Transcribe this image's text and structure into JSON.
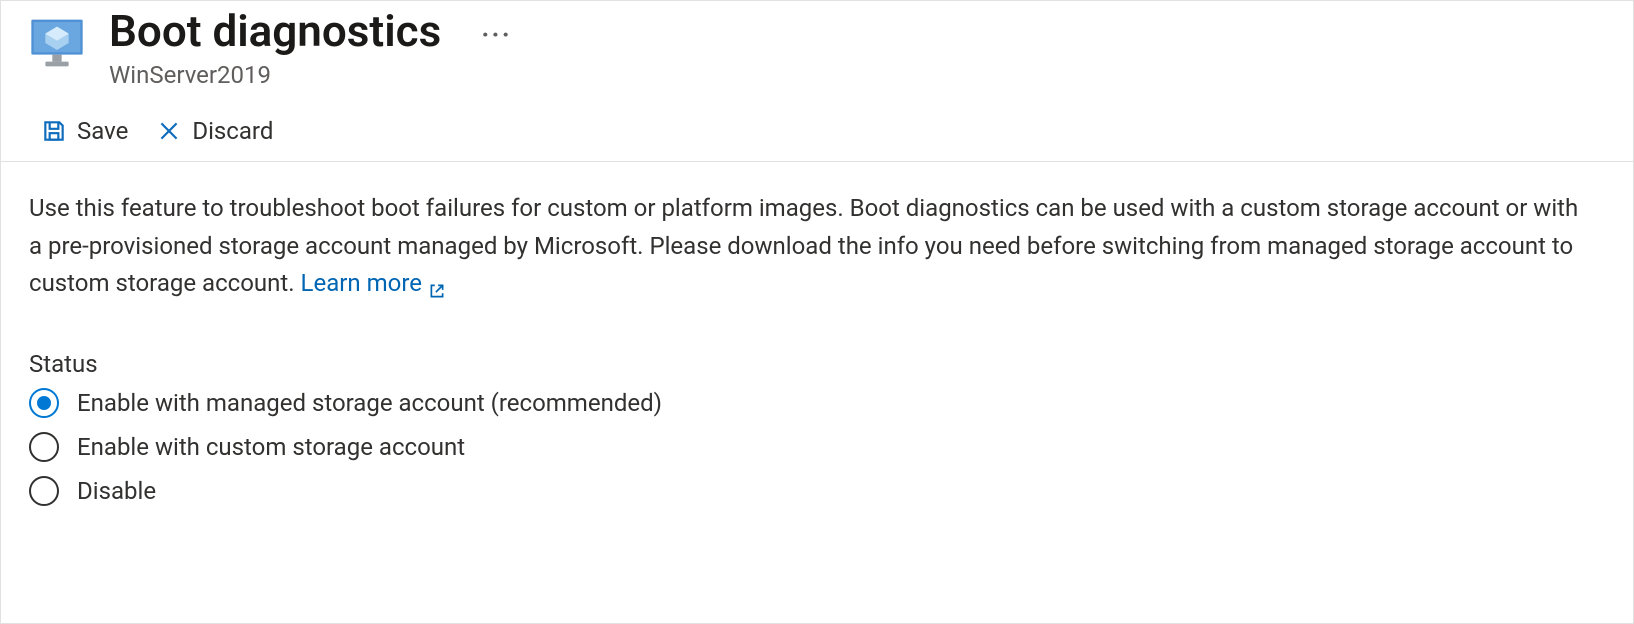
{
  "header": {
    "title": "Boot diagnostics",
    "subtitle": "WinServer2019"
  },
  "toolbar": {
    "save_label": "Save",
    "discard_label": "Discard"
  },
  "description": {
    "text": "Use this feature to troubleshoot boot failures for custom or platform images. Boot diagnostics can be used with a custom storage account or with a pre-provisioned storage account managed by Microsoft. Please download the info you need before switching from managed storage account to custom storage account.",
    "learn_more": "Learn more"
  },
  "status": {
    "label": "Status",
    "options": [
      {
        "label": "Enable with managed storage account (recommended)",
        "checked": true
      },
      {
        "label": "Enable with custom storage account",
        "checked": false
      },
      {
        "label": "Disable",
        "checked": false
      }
    ]
  }
}
